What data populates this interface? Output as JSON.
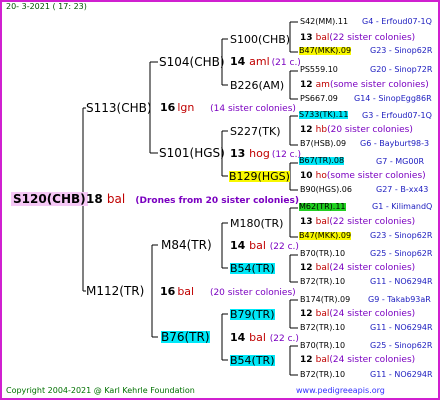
{
  "header": {
    "date": "20-  3-2021 ( 17: 23)"
  },
  "root": {
    "name": "S120(CHB)",
    "num": "18",
    "code": "bal",
    "note": "(Drones from 20 sister colonies)"
  },
  "g1": [
    {
      "name": "S113(CHB)",
      "num": "16",
      "code": "lgn",
      "note": "(14 sister colonies)"
    },
    {
      "name": "M112(TR)",
      "num": "16",
      "code": "bal",
      "note": "(20 sister colonies)"
    }
  ],
  "g2": [
    {
      "name": "S104(CHB)",
      "num": "14",
      "code": "aml",
      "note": "(21 c.)"
    },
    {
      "name": "S101(HGS)",
      "num": "13",
      "code": "hog",
      "note": "(12 c.)"
    },
    {
      "name": "M84(TR)",
      "num": "14",
      "code": "bal",
      "note": "(22 c.)"
    },
    {
      "name": "B76(TR)",
      "num": "14",
      "code": "bal",
      "note": "(22 c.)"
    }
  ],
  "g3": [
    {
      "name": "S100(CHB)",
      "num": "13",
      "code": "bal",
      "note": "(22 sister colonies)"
    },
    {
      "name": "B226(AM)",
      "num": "12",
      "code": "am",
      "note": "(some sister colonies)"
    },
    {
      "name": "S227(TK)",
      "num": "12",
      "code": "hb",
      "note": "(20 sister colonies)"
    },
    {
      "name": "B129(HGS)",
      "num": "10",
      "code": "ho",
      "note": "(some sister colonies)"
    },
    {
      "name": "M180(TR)",
      "num": "13",
      "code": "bal",
      "note": "(22 sister colonies)"
    },
    {
      "name": "B54(TR)",
      "num": "12",
      "code": "bal",
      "note": "(24 sister colonies)"
    },
    {
      "name": "B79(TR)",
      "num": "12",
      "code": "bal",
      "note": "(24 sister colonies)"
    },
    {
      "name": "B54(TR)",
      "num": "12",
      "code": "bal",
      "note": "(24 sister colonies)"
    }
  ],
  "g4": [
    {
      "name": "S42(MM).11",
      "info": "G4 - Erfoud07-1Q"
    },
    {
      "name": "B47(MKK).09",
      "info": "G23 - Sinop62R"
    },
    {
      "name": "PS559.10",
      "info": "G20 - Sinop72R"
    },
    {
      "name": "PS667.09",
      "info": "G14 - SinopEgg86R"
    },
    {
      "name": "S733(TK).11",
      "info": "G3 - Erfoud07-1Q"
    },
    {
      "name": "B7(HSB).09",
      "info": "G6 - Bayburt98-3"
    },
    {
      "name": "B67(TR).08",
      "info": "G7 - MG00R"
    },
    {
      "name": "B90(HGS).06",
      "info": "G27 - B-xx43"
    },
    {
      "name": "M62(TR).11",
      "info": "G1 - KilimandQ"
    },
    {
      "name": "B47(MKK).09",
      "info": "G23 - Sinop62R"
    },
    {
      "name": "B70(TR).10",
      "info": "G25 - Sinop62R"
    },
    {
      "name": "B72(TR).10",
      "info": "G11 - NO6294R"
    },
    {
      "name": "B174(TR).09",
      "info": "G9 - Takab93aR"
    },
    {
      "name": "B72(TR).10",
      "info": "G11 - NO6294R"
    },
    {
      "name": "B70(TR).10",
      "info": "G25 - Sinop62R"
    },
    {
      "name": "B72(TR).10",
      "info": "G11 - NO6294R"
    }
  ],
  "footer": {
    "copyright": "Copyright 2004-2021 @ Karl Kehrle Foundation",
    "url": "www.pedigreeapis.org"
  }
}
